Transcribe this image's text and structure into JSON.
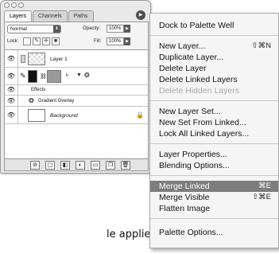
{
  "palette": {
    "tabs": [
      "Layers",
      "Channels",
      "Paths"
    ],
    "blend_mode": "Normal",
    "opacity_label": "Opacity:",
    "opacity_value": "100%",
    "lock_label": "Lock:",
    "fill_label": "Fill:",
    "fill_value": "100%",
    "layers": [
      {
        "name": "Layer 1"
      },
      {
        "name": "Effects"
      },
      {
        "name": "Gradient Overlay"
      },
      {
        "name": "Background"
      }
    ],
    "bottom_icons": [
      "link-icon",
      "layer-style-icon",
      "mask-icon",
      "adjustment-icon",
      "new-set-icon",
      "new-layer-icon",
      "trash-icon"
    ]
  },
  "caption": "le applied.",
  "menu": {
    "items": [
      {
        "label": "Dock to Palette Well",
        "shortcut": ""
      },
      {
        "label": "New Layer...",
        "shortcut": "⇧⌘N"
      },
      {
        "label": "Duplicate Layer...",
        "shortcut": ""
      },
      {
        "label": "Delete Layer",
        "shortcut": ""
      },
      {
        "label": "Delete Linked Layers",
        "shortcut": ""
      },
      {
        "label": "Delete Hidden Layers",
        "shortcut": ""
      },
      {
        "label": "New Layer Set...",
        "shortcut": ""
      },
      {
        "label": "New Set From Linked...",
        "shortcut": ""
      },
      {
        "label": "Lock All Linked Layers...",
        "shortcut": ""
      },
      {
        "label": "Layer Properties...",
        "shortcut": ""
      },
      {
        "label": "Blending Options...",
        "shortcut": ""
      },
      {
        "label": "Merge Linked",
        "shortcut": "⌘E"
      },
      {
        "label": "Merge Visible",
        "shortcut": "⇧⌘E"
      },
      {
        "label": "Flatten Image",
        "shortcut": ""
      },
      {
        "label": "Palette Options...",
        "shortcut": ""
      }
    ]
  },
  "colors": {
    "highlight": "#7d7d7d",
    "disabled_text": "#a8a8a8",
    "menu_bg": "#f5f5f5",
    "palette_bg": "#e9e9e9"
  }
}
